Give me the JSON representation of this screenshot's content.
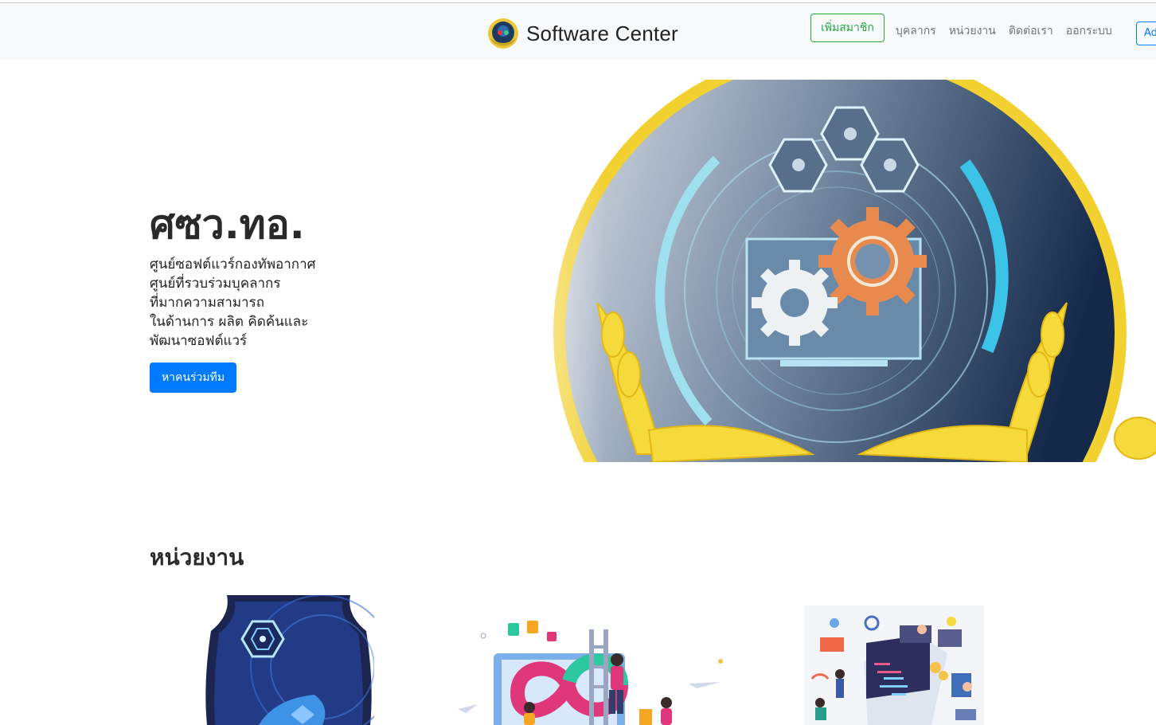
{
  "navbar": {
    "brand": "Software Center",
    "join_button": "เพิ่มสมาชิก",
    "links": [
      "บุคลากร",
      "หน่วยงาน",
      "ติดต่อเรา",
      "ออกระบบ"
    ],
    "admin_button": "Ad"
  },
  "hero": {
    "title": "ศซว.ทอ.",
    "description_lines": [
      "ศูนย์ซอฟต์แวร์กองทัพอากาศ",
      "ศูนย์ที่รวบร่วมบุคลากร",
      "ที่มากความสามารถ",
      "ในด้านการ ผลิต คิดค้นและ",
      "พัฒนาซอฟต์แวร์"
    ],
    "cta": "หาคนร่วมทีม"
  },
  "units": {
    "title": "หน่วยงาน"
  },
  "colors": {
    "primary": "#007bff",
    "success": "#28a745",
    "navbar_bg": "#f8f9fa",
    "emblem_gold": "#f2d43a",
    "emblem_navy": "#1e3a5f",
    "gear_orange": "#e8894e"
  }
}
